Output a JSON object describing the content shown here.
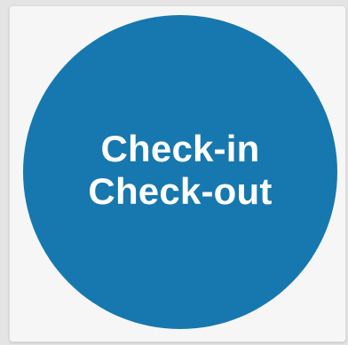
{
  "tile": {
    "line1": "Check-in",
    "line2": "Check-out"
  },
  "colors": {
    "circle": "#1678ae",
    "text": "#ffffff",
    "tile_background": "#f6f6f7"
  }
}
